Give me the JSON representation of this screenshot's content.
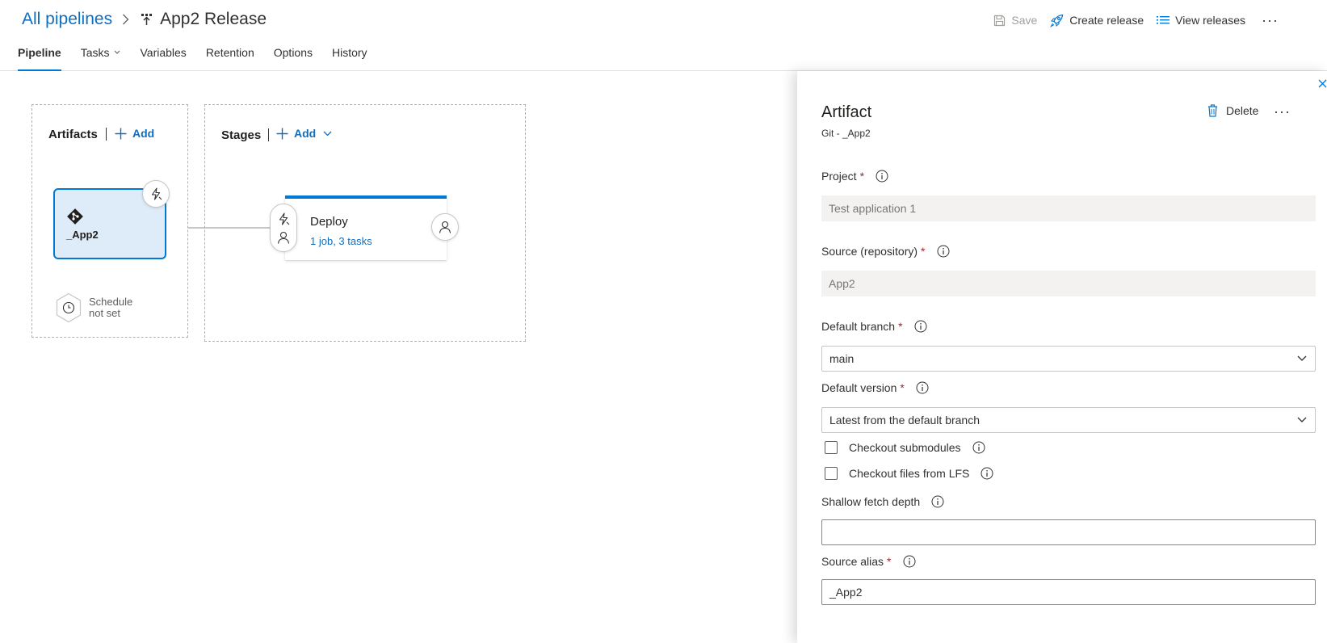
{
  "header": {
    "breadcrumb_link": "All pipelines",
    "title": "App2 Release",
    "toolbar": {
      "save": "Save",
      "create_release": "Create release",
      "view_releases": "View releases",
      "more": "···"
    },
    "tabs": [
      {
        "label": "Pipeline",
        "active": true
      },
      {
        "label": "Tasks",
        "active": false
      },
      {
        "label": "Variables",
        "active": false
      },
      {
        "label": "Retention",
        "active": false
      },
      {
        "label": "Options",
        "active": false
      },
      {
        "label": "History",
        "active": false
      }
    ]
  },
  "canvas": {
    "artifacts": {
      "title": "Artifacts",
      "add": "Add",
      "card_name": "_App2",
      "schedule_line1": "Schedule",
      "schedule_line2": "not set"
    },
    "stages": {
      "title": "Stages",
      "add": "Add",
      "stage_name": "Deploy",
      "stage_summary": "1 job, 3 tasks"
    }
  },
  "panel": {
    "title": "Artifact",
    "subtitle": "Git - _App2",
    "delete": "Delete",
    "more": "···",
    "fields": {
      "project": {
        "label": "Project",
        "value": "Test application 1"
      },
      "source": {
        "label": "Source (repository)",
        "value": "App2"
      },
      "default_branch": {
        "label": "Default branch",
        "value": "main"
      },
      "default_version": {
        "label": "Default version",
        "value": "Latest from the default branch"
      },
      "checkout_submodules": {
        "label": "Checkout submodules",
        "checked": false
      },
      "checkout_lfs": {
        "label": "Checkout files from LFS",
        "checked": false
      },
      "shallow_fetch": {
        "label": "Shallow fetch depth",
        "value": ""
      },
      "source_alias": {
        "label": "Source alias",
        "value": "_App2"
      }
    },
    "required_mark": "*"
  },
  "colors": {
    "accent": "#0078d4",
    "link": "#106ebe",
    "required": "#a4262c",
    "card_selected_bg": "#deecf9"
  }
}
